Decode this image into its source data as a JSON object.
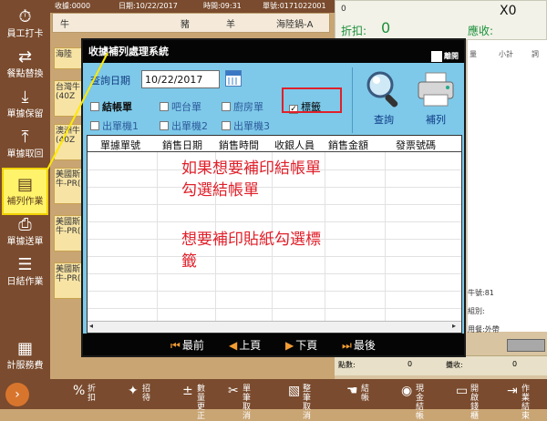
{
  "topbar": {
    "receipt": "收據:0000",
    "date": "日期:10/22/2017",
    "time": "時間:09:31",
    "single": "單號:0171022001"
  },
  "product_header": [
    "牛",
    "豬",
    "羊",
    "海陸鍋-A"
  ],
  "tiles": [
    "海陸",
    "台灣牛(40Z",
    "澳洲牛(40Z",
    "美國斯牛-PR(",
    "美國斯牛-PR(",
    "美國斯牛-PR("
  ],
  "sidebar": [
    {
      "icon": "clock-icon",
      "label": "員工打卡"
    },
    {
      "icon": "swap-icon",
      "label": "餐點替換"
    },
    {
      "icon": "download-icon",
      "label": "單據保留"
    },
    {
      "icon": "upload-icon",
      "label": "單據取回"
    },
    {
      "icon": "document-icon",
      "label": "補列作業"
    },
    {
      "icon": "printer-icon",
      "label": "單據送單"
    },
    {
      "icon": "database-icon",
      "label": "日結作業"
    },
    {
      "icon": "calculator-icon",
      "label": "計服務費"
    }
  ],
  "right_panel": {
    "x0": "X0",
    "discount_label": "折扣:",
    "discount_value": "0",
    "receivable_label": "應收:",
    "list_headers": [
      "量",
      "小計",
      "詞"
    ],
    "table_no": "牛號:81",
    "category": "組別:",
    "service": "用餐:外帶",
    "points_label": "點數:",
    "points_value": "0",
    "received_label": "攤收:",
    "received_value": "0"
  },
  "bottom_bar": [
    {
      "icon": "percent-icon",
      "label": "折扣"
    },
    {
      "icon": "gift-icon",
      "label": "招待"
    },
    {
      "icon": "plus-minus-icon",
      "label": "數量更正"
    },
    {
      "icon": "scissors-icon",
      "label": "單筆取消"
    },
    {
      "icon": "clipboard-icon",
      "label": "整筆取消"
    },
    {
      "icon": "hand-icon",
      "label": "結帳"
    },
    {
      "icon": "coins-icon",
      "label": "現金結帳"
    },
    {
      "icon": "cash-drawer-icon",
      "label": "開啟錢櫃"
    },
    {
      "icon": "exit-icon",
      "label": "作業結束"
    }
  ],
  "dialog": {
    "title": "收據補列處理系統",
    "logo": "離開",
    "date_label": "查詢日期",
    "date_value": "10/22/2017",
    "checkboxes": [
      {
        "label": "結帳單",
        "checked": false
      },
      {
        "label": "吧台單",
        "checked": false
      },
      {
        "label": "廚房單",
        "checked": false
      },
      {
        "label": "標籤",
        "checked": true
      },
      {
        "label": "出單機1",
        "checked": false
      },
      {
        "label": "出單機2",
        "checked": false
      },
      {
        "label": "出單機3",
        "checked": false
      }
    ],
    "search_label": "查詢",
    "reprint_label": "補列",
    "columns": [
      "單據單號",
      "銷售日期",
      "銷售時間",
      "收銀人員",
      "銷售金額",
      "發票號碼"
    ],
    "annotation1_line1": "如果想要補印結帳單",
    "annotation1_line2": "勾選結帳單",
    "annotation2_line1": "想要補印貼紙勾選標",
    "annotation2_line2": "籤",
    "nav": [
      "最前",
      "上頁",
      "下頁",
      "最後"
    ]
  }
}
